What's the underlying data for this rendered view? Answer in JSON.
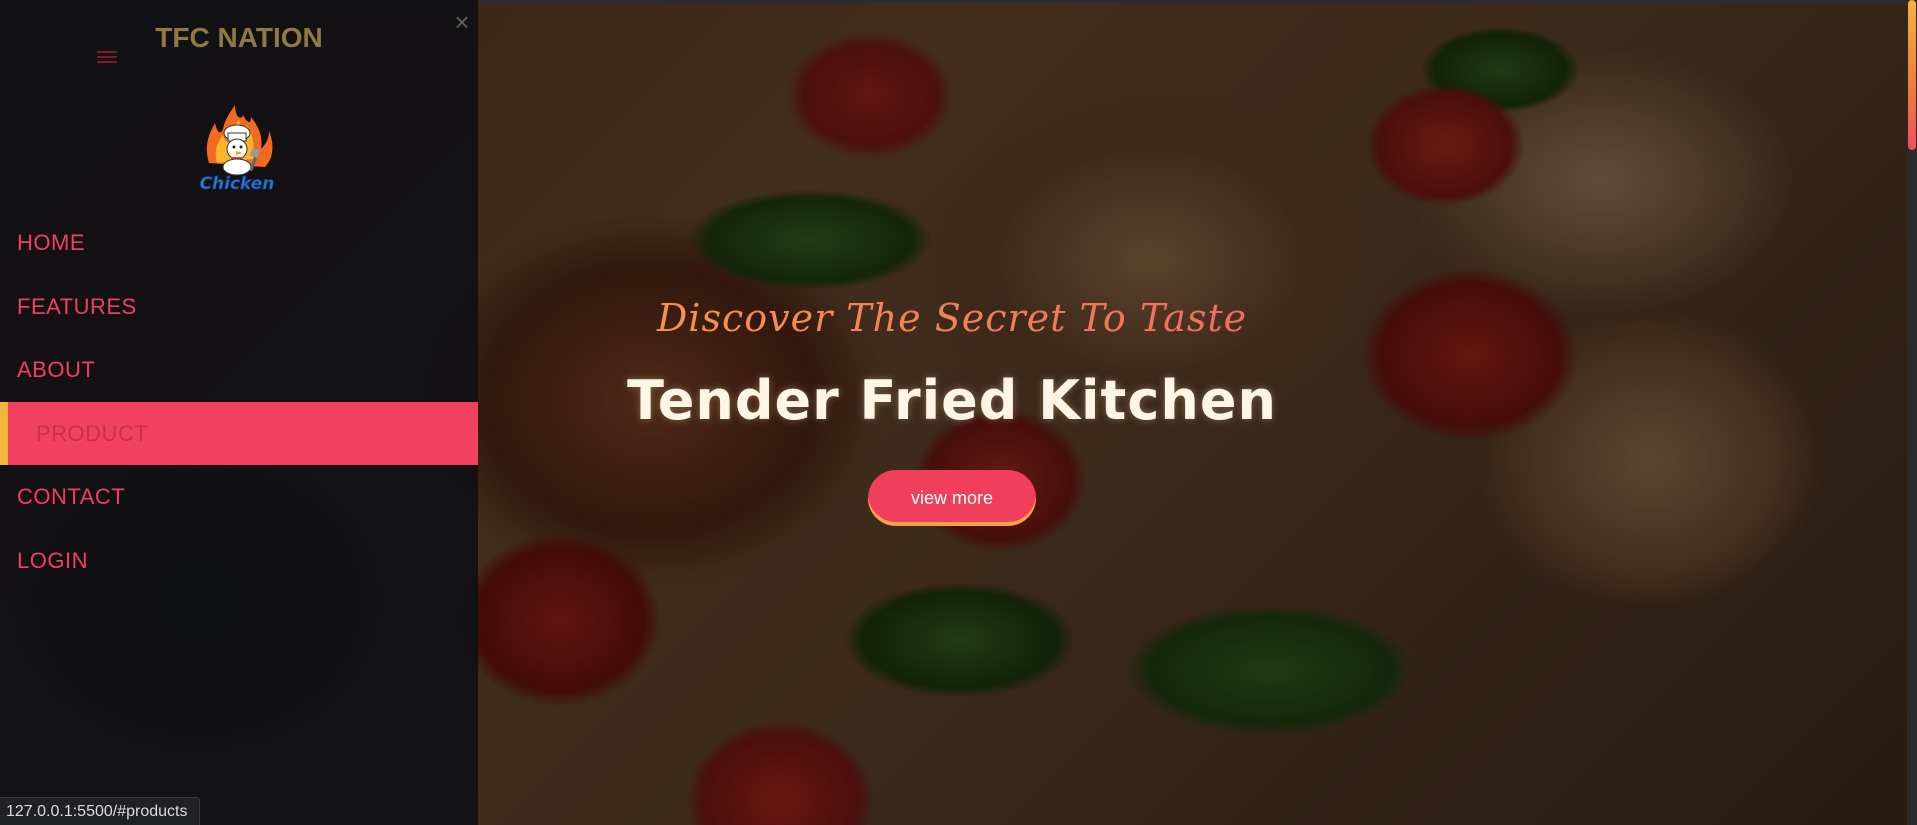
{
  "sidebar": {
    "title": "TFC NATION",
    "logo_text": "Chicken",
    "close_symbol": "×",
    "nav": [
      {
        "label": "HOME"
      },
      {
        "label": "FEATURES"
      },
      {
        "label": "ABOUT"
      },
      {
        "label": "PRODUCT"
      },
      {
        "label": "CONTACT"
      },
      {
        "label": "LOGIN"
      }
    ],
    "active_item": "PRODUCT"
  },
  "hero": {
    "tagline": "Discover The Secret To Taste",
    "title": "Tender Fried Kitchen",
    "button_label": "view more"
  },
  "status_bar": {
    "url": "127.0.0.1:5500/#products"
  },
  "colors": {
    "accent": "#f2405f",
    "active_marker": "#f6b43d",
    "brand_title": "#8f7a44",
    "sidebar_bg": "#101014"
  },
  "icons": {
    "close": "close-icon",
    "menu": "hamburger-icon",
    "logo": "chicken-logo-icon"
  }
}
